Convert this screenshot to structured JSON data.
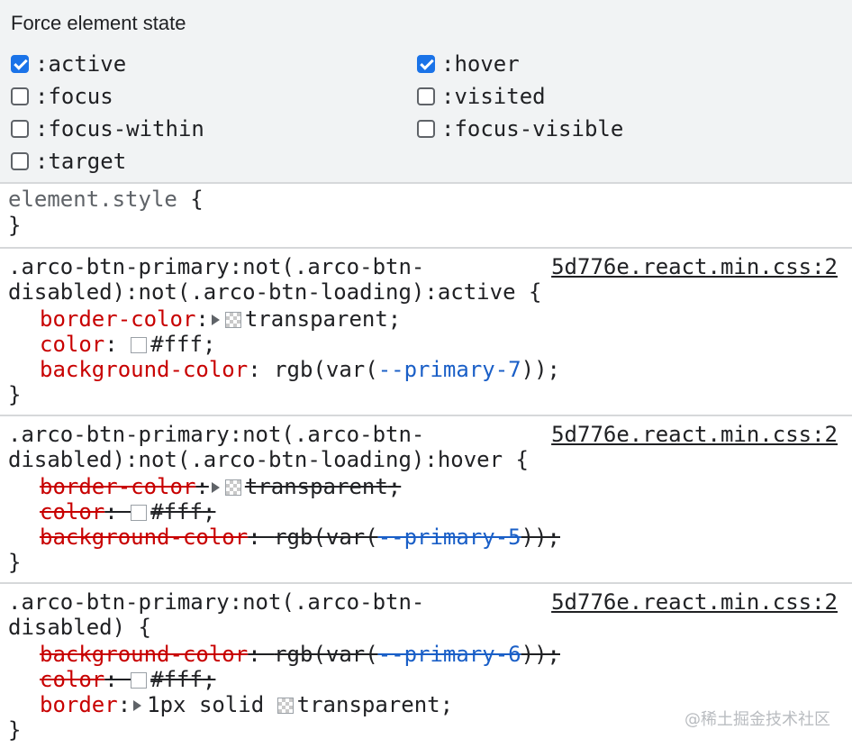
{
  "force_state": {
    "title": "Force element state",
    "items": [
      {
        "label": ":active",
        "checked": true
      },
      {
        "label": ":hover",
        "checked": true
      },
      {
        "label": ":focus",
        "checked": false
      },
      {
        "label": ":visited",
        "checked": false
      },
      {
        "label": ":focus-within",
        "checked": false
      },
      {
        "label": ":focus-visible",
        "checked": false
      },
      {
        "label": ":target",
        "checked": false
      }
    ]
  },
  "element_style": {
    "selector": "element.style",
    "open": " {",
    "close": "}"
  },
  "rules": [
    {
      "selector_line1": ".arco-btn-primary:not(.arco-btn-",
      "selector_line2": "disabled):not(.arco-btn-loading):active {",
      "source": "5d776e.react.min.css:2",
      "decls": [
        {
          "prop": "border-color",
          "sep": ":",
          "value": "transparent",
          "end": ";"
        },
        {
          "prop": "color",
          "sep": ": ",
          "value": "#fff",
          "end": ";"
        },
        {
          "prop": "background-color",
          "sep": ": ",
          "value_a": "rgb(var(",
          "value_var": "--primary-7",
          "value_b": "));"
        }
      ],
      "close": "}"
    },
    {
      "selector_line1": ".arco-btn-primary:not(.arco-btn-",
      "selector_line2": "disabled):not(.arco-btn-loading):hover {",
      "source": "5d776e.react.min.css:2",
      "decls": [
        {
          "prop": "border-color",
          "sep": ":",
          "value": "transparent",
          "end": ";"
        },
        {
          "prop": "color",
          "sep": ": ",
          "value": "#fff",
          "end": ";"
        },
        {
          "prop": "background-color",
          "sep": ": ",
          "value_a": "rgb(var(",
          "value_var": "--primary-5",
          "value_b": "));"
        }
      ],
      "close": "}"
    },
    {
      "selector_line1": ".arco-btn-primary:not(.arco-btn-",
      "selector_line2": "disabled) {",
      "source": "5d776e.react.min.css:2",
      "decls": [
        {
          "prop": "background-color",
          "sep": ": ",
          "value_a": "rgb(var(",
          "value_var": "--primary-6",
          "value_b": "));"
        },
        {
          "prop": "color",
          "sep": ": ",
          "value": "#fff",
          "end": ";"
        },
        {
          "prop": "border",
          "sep": ":",
          "value_pre": "1px solid ",
          "value": "transparent",
          "end": ";"
        }
      ],
      "close": "}"
    }
  ],
  "watermark": "@稀土掘金技术社区",
  "colors": {
    "checkbox_checked": "#1a73e8",
    "property": "#c80000",
    "variable": "#1a5fc7",
    "panel_bg": "#f1f3f4"
  }
}
